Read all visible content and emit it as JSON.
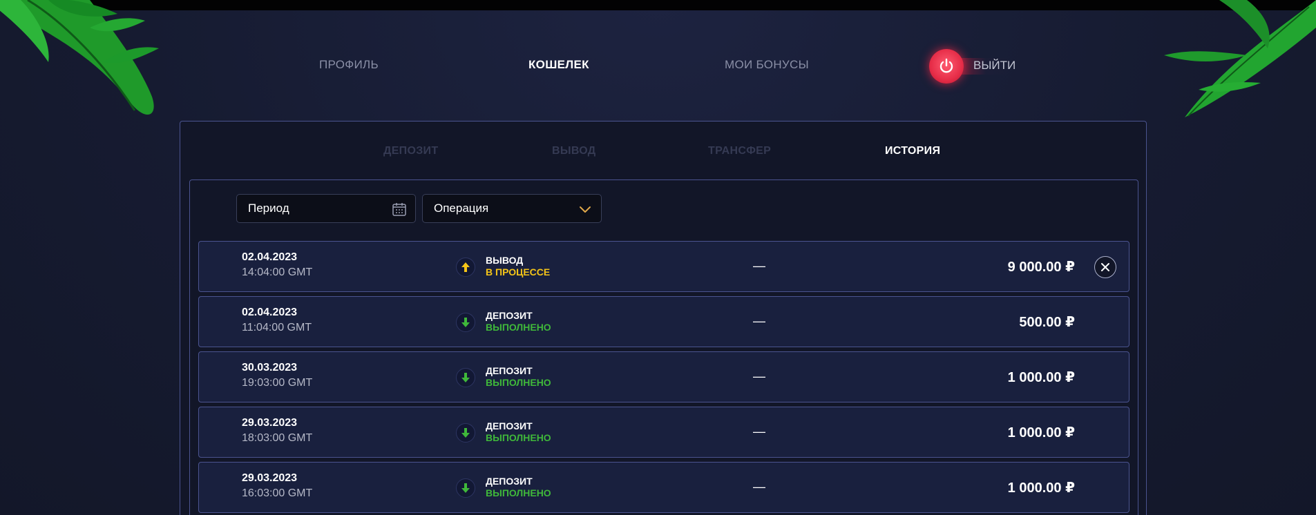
{
  "nav": {
    "profile": "ПРОФИЛЬ",
    "wallet": "КОШЕЛЕК",
    "bonuses": "МОИ БОНУСЫ",
    "logout": "ВЫЙТИ"
  },
  "subtabs": {
    "deposit": "ДЕПОЗИТ",
    "withdraw": "ВЫВОД",
    "transfer": "ТРАНСФЕР",
    "history": "ИСТОРИЯ"
  },
  "filters": {
    "period": "Период",
    "operation": "Операция"
  },
  "transactions": [
    {
      "date": "02.04.2023",
      "time": "14:04:00 GMT",
      "type": "ВЫВОД",
      "status": "В ПРОЦЕССЕ",
      "status_kind": "pending",
      "direction": "up",
      "details": "—",
      "amount": "9 000.00 ₽",
      "cancellable": true
    },
    {
      "date": "02.04.2023",
      "time": "11:04:00 GMT",
      "type": "ДЕПОЗИТ",
      "status": "ВЫПОЛНЕНО",
      "status_kind": "done",
      "direction": "down",
      "details": "—",
      "amount": "500.00 ₽",
      "cancellable": false
    },
    {
      "date": "30.03.2023",
      "time": "19:03:00 GMT",
      "type": "ДЕПОЗИТ",
      "status": "ВЫПОЛНЕНО",
      "status_kind": "done",
      "direction": "down",
      "details": "—",
      "amount": "1 000.00 ₽",
      "cancellable": false
    },
    {
      "date": "29.03.2023",
      "time": "18:03:00 GMT",
      "type": "ДЕПОЗИТ",
      "status": "ВЫПОЛНЕНО",
      "status_kind": "done",
      "direction": "down",
      "details": "—",
      "amount": "1 000.00 ₽",
      "cancellable": false
    },
    {
      "date": "29.03.2023",
      "time": "16:03:00 GMT",
      "type": "ДЕПОЗИТ",
      "status": "ВЫПОЛНЕНО",
      "status_kind": "done",
      "direction": "down",
      "details": "—",
      "amount": "1 000.00 ₽",
      "cancellable": false
    }
  ],
  "colors": {
    "accent_red": "#e62d48",
    "pending": "#f5c518",
    "done": "#3fb83a",
    "border": "#4b5490"
  }
}
